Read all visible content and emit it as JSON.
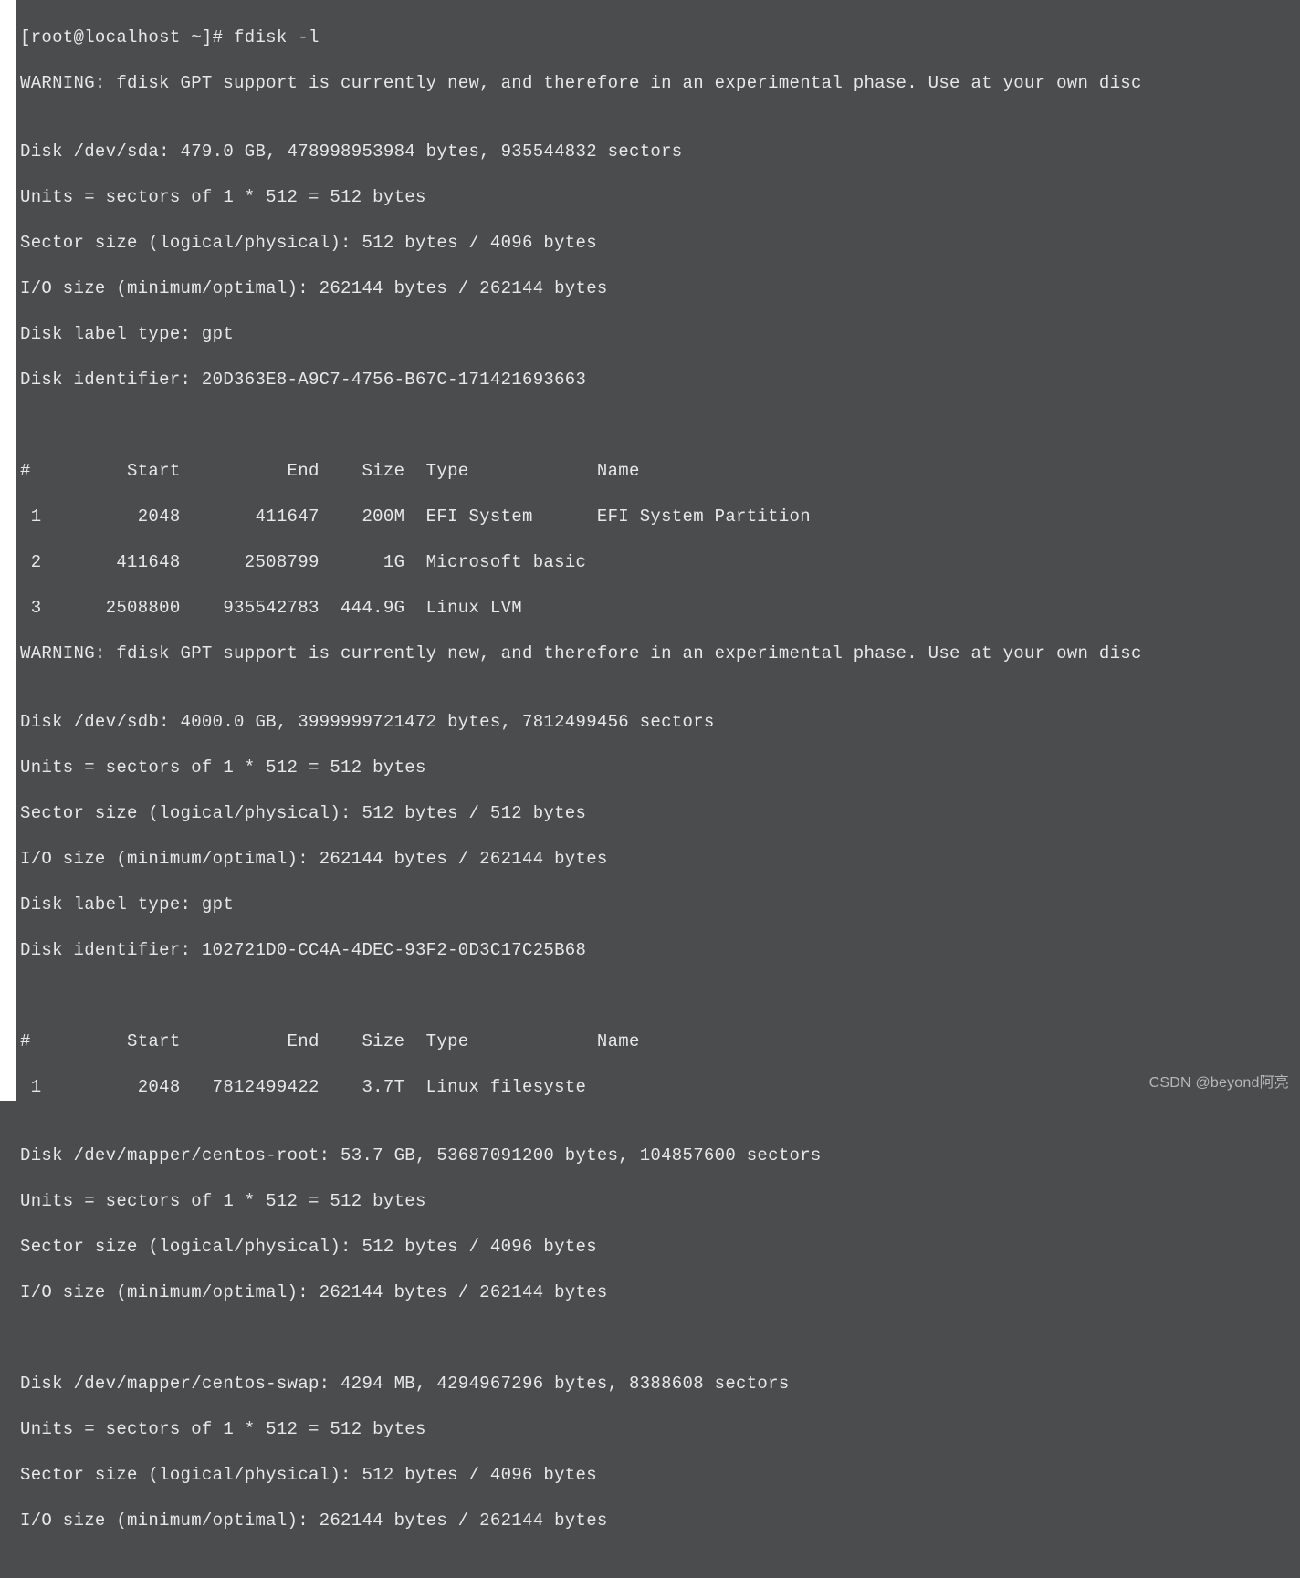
{
  "watermark": "CSDN @beyond阿亮",
  "lines": {
    "l0": "[root@localhost ~]# fdisk -l",
    "l1": "WARNING: fdisk GPT support is currently new, and therefore in an experimental phase. Use at your own disc",
    "l2": "",
    "l3": "Disk /dev/sda: 479.0 GB, 478998953984 bytes, 935544832 sectors",
    "l4": "Units = sectors of 1 * 512 = 512 bytes",
    "l5": "Sector size (logical/physical): 512 bytes / 4096 bytes",
    "l6": "I/O size (minimum/optimal): 262144 bytes / 262144 bytes",
    "l7": "Disk label type: gpt",
    "l8": "Disk identifier: 20D363E8-A9C7-4756-B67C-171421693663",
    "l9": "",
    "l10": "",
    "l11": "#         Start          End    Size  Type            Name",
    "l12": " 1         2048       411647    200M  EFI System      EFI System Partition",
    "l13": " 2       411648      2508799      1G  Microsoft basic ",
    "l14": " 3      2508800    935542783  444.9G  Linux LVM       ",
    "l15": "WARNING: fdisk GPT support is currently new, and therefore in an experimental phase. Use at your own disc",
    "l16": "",
    "l17": "Disk /dev/sdb: 4000.0 GB, 3999999721472 bytes, 7812499456 sectors",
    "l18": "Units = sectors of 1 * 512 = 512 bytes",
    "l19": "Sector size (logical/physical): 512 bytes / 512 bytes",
    "l20": "I/O size (minimum/optimal): 262144 bytes / 262144 bytes",
    "l21": "Disk label type: gpt",
    "l22": "Disk identifier: 102721D0-CC4A-4DEC-93F2-0D3C17C25B68",
    "l23": "",
    "l24": "",
    "l25": "#         Start          End    Size  Type            Name",
    "l26": " 1         2048   7812499422    3.7T  Linux filesyste ",
    "l27": "",
    "l28": "Disk /dev/mapper/centos-root: 53.7 GB, 53687091200 bytes, 104857600 sectors",
    "l29": "Units = sectors of 1 * 512 = 512 bytes",
    "l30": "Sector size (logical/physical): 512 bytes / 4096 bytes",
    "l31": "I/O size (minimum/optimal): 262144 bytes / 262144 bytes",
    "l32": "",
    "l33": "",
    "l34": "Disk /dev/mapper/centos-swap: 4294 MB, 4294967296 bytes, 8388608 sectors",
    "l35": "Units = sectors of 1 * 512 = 512 bytes",
    "l36": "Sector size (logical/physical): 512 bytes / 4096 bytes",
    "l37": "I/O size (minimum/optimal): 262144 bytes / 262144 bytes",
    "l38": ""
  }
}
